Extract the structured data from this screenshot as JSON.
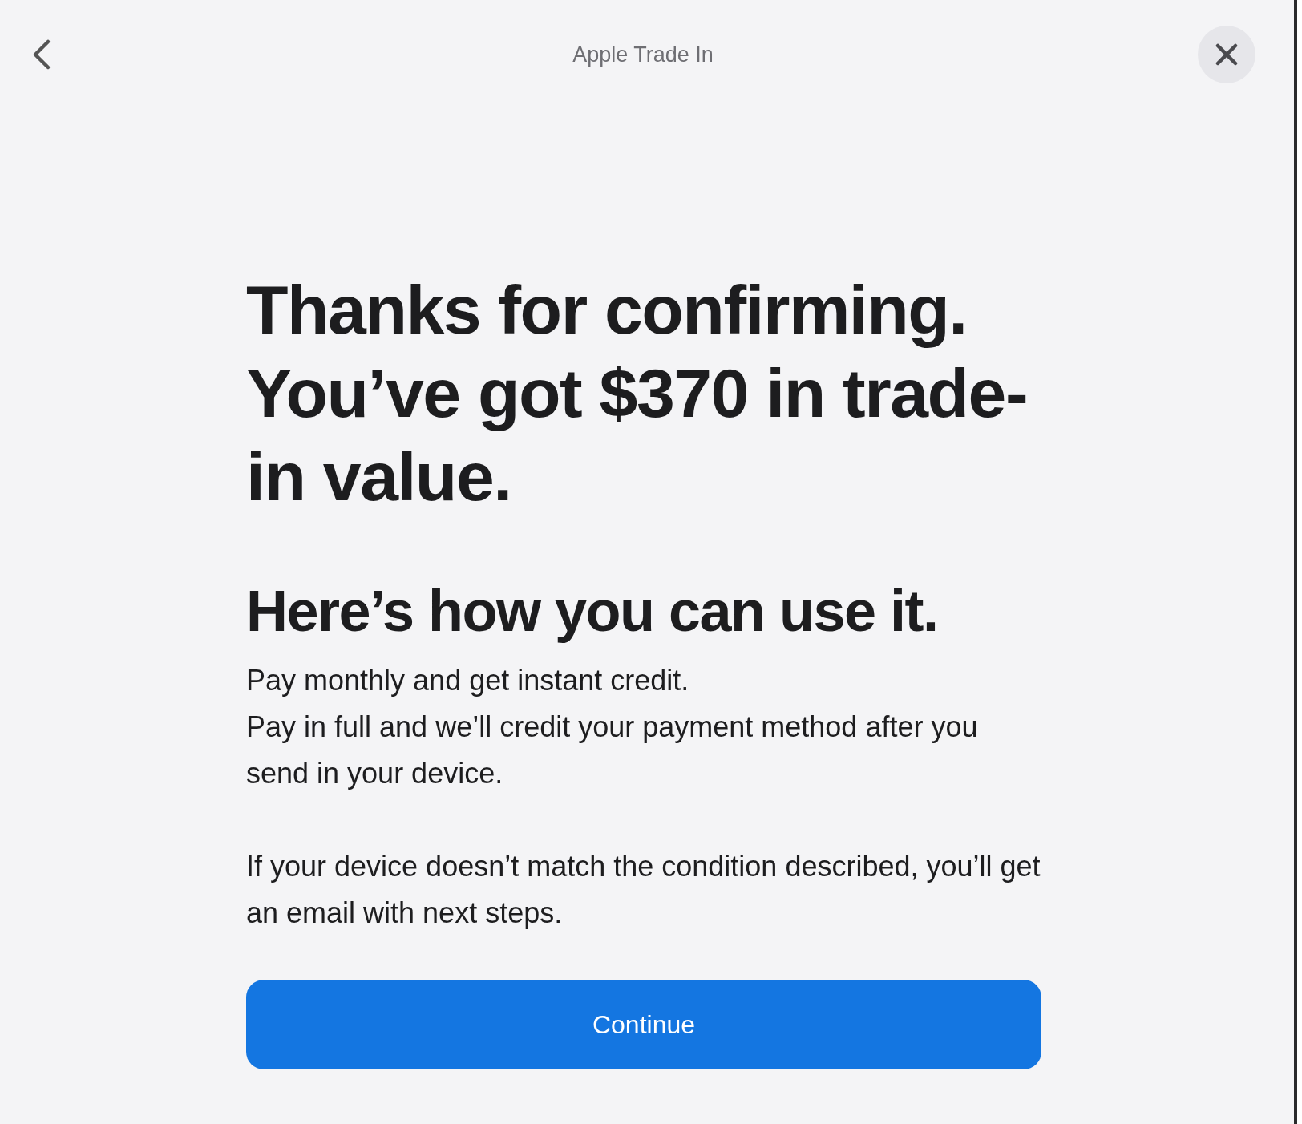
{
  "header": {
    "title": "Apple Trade In"
  },
  "heading": "Thanks for confirming. You’ve got $370 in trade-in value.",
  "subheading": "Here’s how you can use it.",
  "paragraphs": [
    "Pay monthly and get instant credit.",
    "Pay in full and we’ll credit your payment method after you send in your device.",
    "If your device doesn’t match the condition described, you’ll get an email with next steps."
  ],
  "button": {
    "label": "Continue"
  }
}
